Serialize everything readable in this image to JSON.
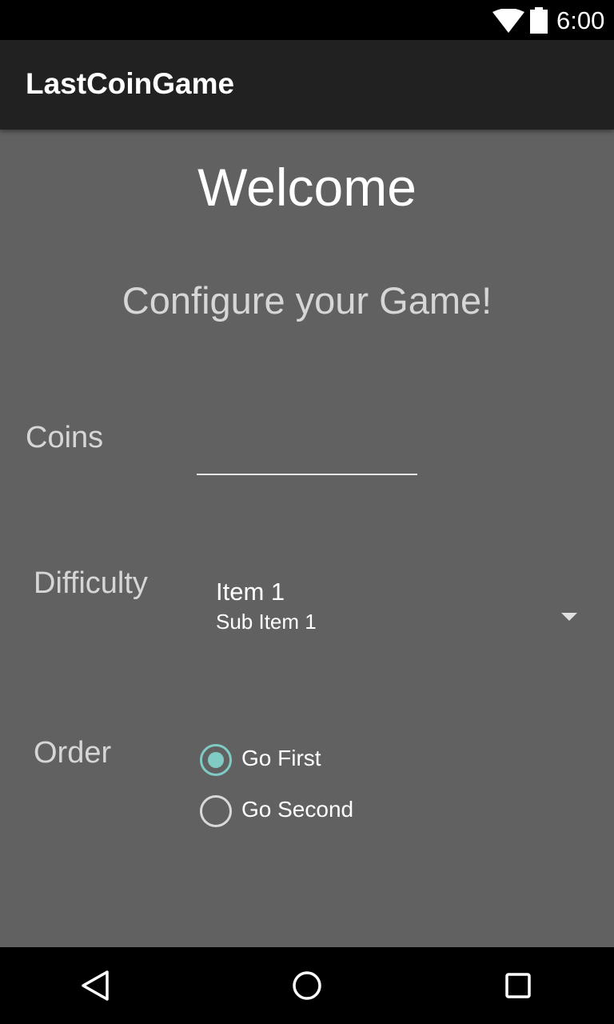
{
  "status_bar": {
    "time": "6:00",
    "icons": [
      "wifi-icon",
      "battery-icon"
    ]
  },
  "app_bar": {
    "title": "LastCoinGame"
  },
  "main": {
    "heading": "Welcome",
    "subtitle": "Configure your Game!",
    "coins": {
      "label": "Coins",
      "value": "",
      "placeholder": ""
    },
    "difficulty": {
      "label": "Difficulty",
      "selected_item": "Item 1",
      "selected_sub_item": "Sub Item 1",
      "icon": "dropdown-arrow-icon"
    },
    "order": {
      "label": "Order",
      "options": [
        {
          "label": "Go First",
          "checked": true
        },
        {
          "label": "Go Second",
          "checked": false
        }
      ]
    }
  },
  "nav_bar": {
    "buttons": [
      "back-icon",
      "home-icon",
      "recents-icon"
    ]
  },
  "colors": {
    "background": "#616161",
    "app_bar": "#212121",
    "accent": "#80cbc4"
  }
}
